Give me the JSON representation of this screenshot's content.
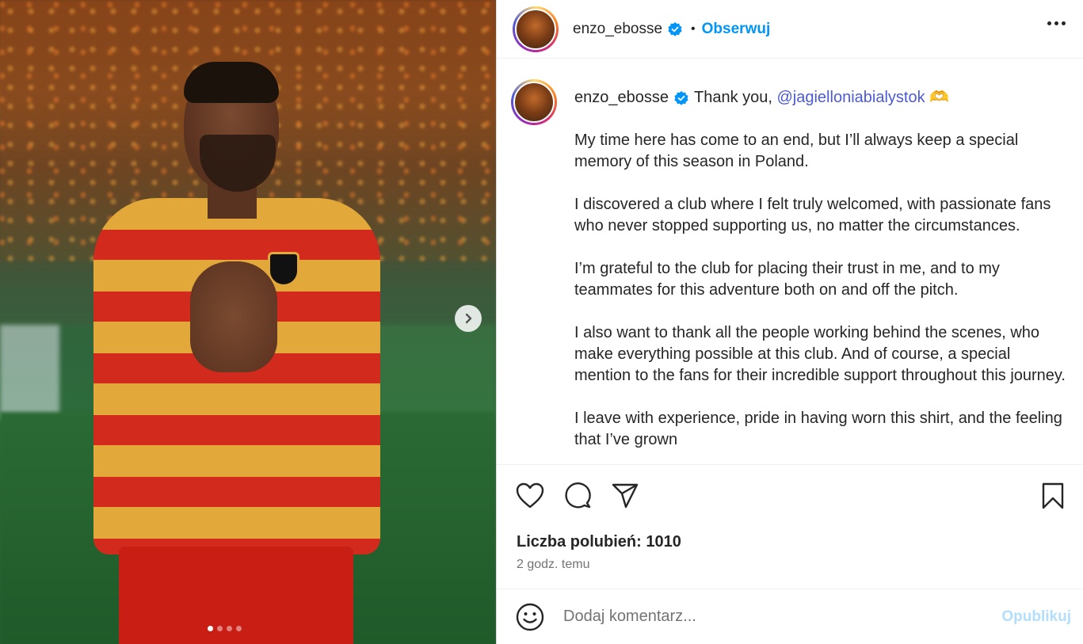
{
  "post": {
    "username": "enzo_ebosse",
    "bullet": "•",
    "follow_label": "Obserwuj",
    "caption": {
      "username": "enzo_ebosse",
      "lead": "Thank you,",
      "mention": "@jagielloniabialystok",
      "emoji": "🫶",
      "paragraphs": [
        "My time here has come to an end, but I’ll always keep a special memory of this season in Poland.",
        "I discovered a club where I felt truly welcomed, with passionate fans who never stopped supporting us, no matter the circumstances.",
        "I’m grateful to the club for placing their trust in me, and to my teammates for this adventure both on and off the pitch.",
        "I also want to thank all the people working behind the scenes, who make everything possible at this club. And of course, a special mention to the fans for their incredible support throughout this journey.",
        "I leave with experience, pride in having worn this shirt, and the feeling that I’ve grown"
      ]
    },
    "likes_text": "Liczba polubień: 1010",
    "time_text": "2 godz. temu",
    "comment_placeholder": "Dodaj komentarz...",
    "publish_label": "Opublikuj"
  },
  "carousel": {
    "slide_count": 4,
    "active_index": 0
  },
  "icons": {
    "verified": "verified-badge-icon",
    "more": "more-options-icon",
    "like": "heart-icon",
    "comment": "comment-icon",
    "share": "share-icon",
    "save": "bookmark-icon",
    "emoji": "emoji-icon",
    "next": "chevron-right-icon"
  },
  "colors": {
    "accent": "#0095f6",
    "mention": "#4c5bd4",
    "publish_disabled": "#b3dffc",
    "verified": "#0095f6"
  }
}
